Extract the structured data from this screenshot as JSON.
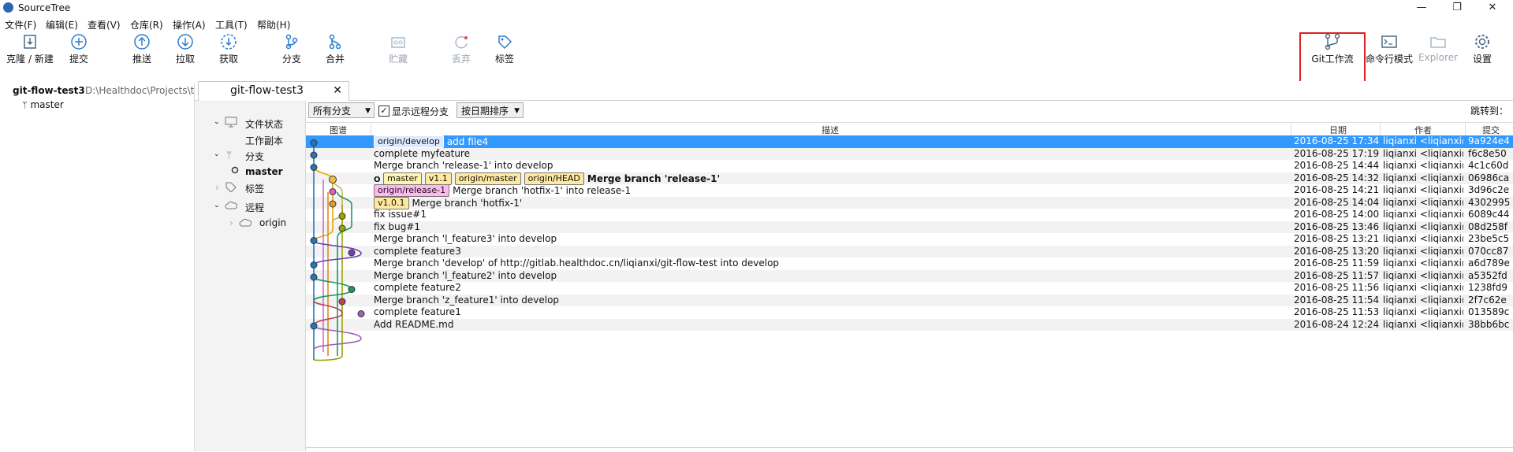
{
  "window": {
    "title": "SourceTree",
    "minimize": "—",
    "maximize": "❐",
    "close": "✕"
  },
  "menu": [
    "文件(F)",
    "编辑(E)",
    "查看(V)",
    "仓库(R)",
    "操作(A)",
    "工具(T)",
    "帮助(H)"
  ],
  "toolbar": {
    "clone": "克隆 / 新建",
    "commit": "提交",
    "push": "推送",
    "pull": "拉取",
    "fetch": "获取",
    "branch": "分支",
    "merge": "合并",
    "stash": "贮藏",
    "discard": "丢弃",
    "tag": "标签",
    "gitflow": "Git工作流",
    "terminal": "命令行模式",
    "explorer": "Explorer",
    "settings": "设置"
  },
  "repo": {
    "name": "git-flow-test3",
    "path": "D:\\Healthdoc\\Projects\\t",
    "branch": "master"
  },
  "tab": {
    "label": "git-flow-test3",
    "close": "✕"
  },
  "sidebar": {
    "file_status": "文件状态",
    "working_copy": "工作副本",
    "branches": "分支",
    "current_branch": "master",
    "tags": "标签",
    "remotes": "远程",
    "remote_origin": "origin"
  },
  "filters": {
    "branches": "所有分支",
    "show_remote": "显示远程分支",
    "sort": "按日期排序",
    "jump_to": "跳转到："
  },
  "columns": {
    "graph": "图谱",
    "description": "描述",
    "date": "日期",
    "author": "作者",
    "commit": "提交"
  },
  "commits": [
    {
      "refs": [
        {
          "t": "remote",
          "n": "origin/develop"
        }
      ],
      "desc": "add file4",
      "date": "2016-08-25 17:34",
      "author": "liqianxi <liqianxi@",
      "hash": "9a924e4"
    },
    {
      "refs": [],
      "desc": "complete myfeature",
      "date": "2016-08-25 17:19",
      "author": "liqianxi <liqianxi@",
      "hash": "f6c8e50"
    },
    {
      "refs": [],
      "desc": "Merge branch 'release-1' into develop",
      "date": "2016-08-25 14:44",
      "author": "liqianxi <liqianxi@",
      "hash": "4c1c60d"
    },
    {
      "refs": [
        {
          "t": "branch",
          "n": "master"
        },
        {
          "t": "tag",
          "n": "v1.1"
        },
        {
          "t": "remote",
          "n": "origin/master"
        },
        {
          "t": "remote",
          "n": "origin/HEAD"
        }
      ],
      "desc": "Merge branch 'release-1'",
      "bold": true,
      "head": true,
      "date": "2016-08-25 14:32",
      "author": "liqianxi <liqianxi@",
      "hash": "06986ca"
    },
    {
      "refs": [
        {
          "t": "remote-pink",
          "n": "origin/release-1"
        }
      ],
      "desc": "Merge branch 'hotfix-1' into release-1",
      "date": "2016-08-25 14:21",
      "author": "liqianxi <liqianxi@",
      "hash": "3d96c2e"
    },
    {
      "refs": [
        {
          "t": "tag",
          "n": "v1.0.1"
        }
      ],
      "desc": "Merge branch 'hotfix-1'",
      "date": "2016-08-25 14:04",
      "author": "liqianxi <liqianxi@",
      "hash": "4302995"
    },
    {
      "refs": [],
      "desc": "fix issue#1",
      "date": "2016-08-25 14:00",
      "author": "liqianxi <liqianxi@",
      "hash": "6089c44"
    },
    {
      "refs": [],
      "desc": "fix bug#1",
      "date": "2016-08-25 13:46",
      "author": "liqianxi <liqianxi@",
      "hash": "08d258f"
    },
    {
      "refs": [],
      "desc": "Merge branch 'l_feature3' into develop",
      "date": "2016-08-25 13:21",
      "author": "liqianxi <liqianxi@",
      "hash": "23be5c5"
    },
    {
      "refs": [],
      "desc": "complete feature3",
      "date": "2016-08-25 13:20",
      "author": "liqianxi <liqianxi@",
      "hash": "070cc87"
    },
    {
      "refs": [],
      "desc": "Merge branch 'develop' of http://gitlab.healthdoc.cn/liqianxi/git-flow-test into develop",
      "date": "2016-08-25 11:59",
      "author": "liqianxi <liqianxi@",
      "hash": "a6d789e"
    },
    {
      "refs": [],
      "desc": "Merge branch 'l_feature2' into develop",
      "date": "2016-08-25 11:57",
      "author": "liqianxi <liqianxi@",
      "hash": "a5352fd"
    },
    {
      "refs": [],
      "desc": "complete feature2",
      "date": "2016-08-25 11:56",
      "author": "liqianxi <liqianxi@",
      "hash": "1238fd9"
    },
    {
      "refs": [],
      "desc": "Merge branch 'z_feature1' into develop",
      "date": "2016-08-25 11:54",
      "author": "liqianxi <liqianxi@",
      "hash": "2f7c62e"
    },
    {
      "refs": [],
      "desc": "complete feature1",
      "date": "2016-08-25 11:53",
      "author": "liqianxi <liqianxi@",
      "hash": "013589c"
    },
    {
      "refs": [],
      "desc": "Add README.md",
      "date": "2016-08-24 12:24",
      "author": "liqianxi <liqianxi@",
      "hash": "38bb6bc"
    }
  ]
}
